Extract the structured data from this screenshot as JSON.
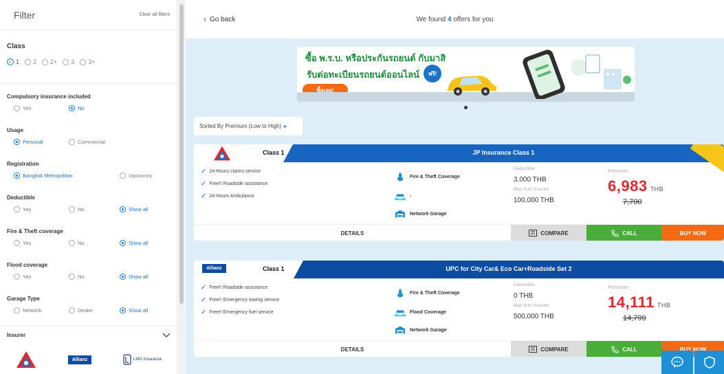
{
  "sidebar": {
    "title": "Filter",
    "clear_all": "Clear all filters",
    "class": {
      "label": "Class",
      "options": [
        {
          "label": "1",
          "selected": true
        },
        {
          "label": "2",
          "selected": false
        },
        {
          "label": "2+",
          "selected": false
        },
        {
          "label": "3",
          "selected": false
        },
        {
          "label": "3+",
          "selected": false
        }
      ]
    },
    "filters": [
      {
        "label": "Compulsory insurance included",
        "options": [
          "Yes",
          "No"
        ],
        "selected": "No"
      },
      {
        "label": "Usage",
        "options": [
          "Personal",
          "Commercial"
        ],
        "selected": "Personal"
      },
      {
        "label": "Registration",
        "options": [
          "Bangkok Metropolitan",
          "Upcountry"
        ],
        "selected": "Bangkok Metropolitan"
      },
      {
        "label": "Deductible",
        "options": [
          "Yes",
          "No",
          "Show all"
        ],
        "selected": "Show all"
      },
      {
        "label": "Fire & Theft coverage",
        "options": [
          "Yes",
          "No",
          "Show all"
        ],
        "selected": "Show all"
      },
      {
        "label": "Flood coverage",
        "options": [
          "Yes",
          "No",
          "Show all"
        ],
        "selected": "Show all"
      },
      {
        "label": "Garage Type",
        "options": [
          "Network",
          "Dealer",
          "Show all"
        ],
        "selected": "Show all"
      }
    ],
    "insurer": {
      "label": "Insurer",
      "logos": [
        "Allianz",
        "LMG Insurance"
      ]
    }
  },
  "main": {
    "go_back": "Go back",
    "found_prefix": "We found ",
    "found_count": "4",
    "found_suffix": " offers for you",
    "banner": {
      "line1": "ซื้อ พ.ร.บ. หรือประกันรถยนต์ กับมาสิ",
      "line2": "รับต่อทะเบียนรถยนต์ออนไลน์",
      "badge": "ฟรี!",
      "cta": "ซื้อเลย!"
    },
    "sort_label": "Sorted By Premium (Low to High)",
    "sort_caret": "▸",
    "offers": [
      {
        "class_label": "Class 1",
        "product": "JP Insurance Class 1",
        "features": [
          "24-Hours claims service",
          "Free!! Roadside assistance",
          "24-Hours Ambulance"
        ],
        "coverages": [
          "Fire & Theft Coverage",
          "-",
          "Network Garage"
        ],
        "deductible_label": "Deductible",
        "deductible": "3,000 THB",
        "max_sum_label": "Max Sum Insured",
        "max_sum": "100,000 THB",
        "premium_label": "Premium",
        "price": "6,983",
        "currency": "THB",
        "old_price": "7,700",
        "details": "DETAILS",
        "compare": "COMPARE",
        "call": "CALL",
        "buy": "BUY NOW"
      },
      {
        "insurer_logo": "Allianz",
        "class_label": "Class 1",
        "product": "UPC for City Car& Eco Car+Roadside Set 2",
        "features": [
          "Free!! Roadside assistance",
          "Free!! Emergency towing service",
          "Free!! Emergency fuel service"
        ],
        "coverages": [
          "Fire & Theft Coverage",
          "Flood Coverage",
          "Network Garage"
        ],
        "deductible_label": "Deductible",
        "deductible": "0 THB",
        "max_sum_label": "Max Sum Insured",
        "max_sum": "500,000 THB",
        "premium_label": "Premium",
        "price": "14,111",
        "currency": "THB",
        "old_price": "14,799",
        "details": "DETAILS",
        "compare": "COMPARE",
        "call": "CALL",
        "buy": "BUY NOW"
      }
    ]
  },
  "colors": {
    "accent": "#1a73c7",
    "header_blue": "#1665c1",
    "price_red": "#e0262f",
    "call_green": "#49ad3a",
    "buy_orange": "#f36a12",
    "page_bg": "#ddeef9"
  }
}
